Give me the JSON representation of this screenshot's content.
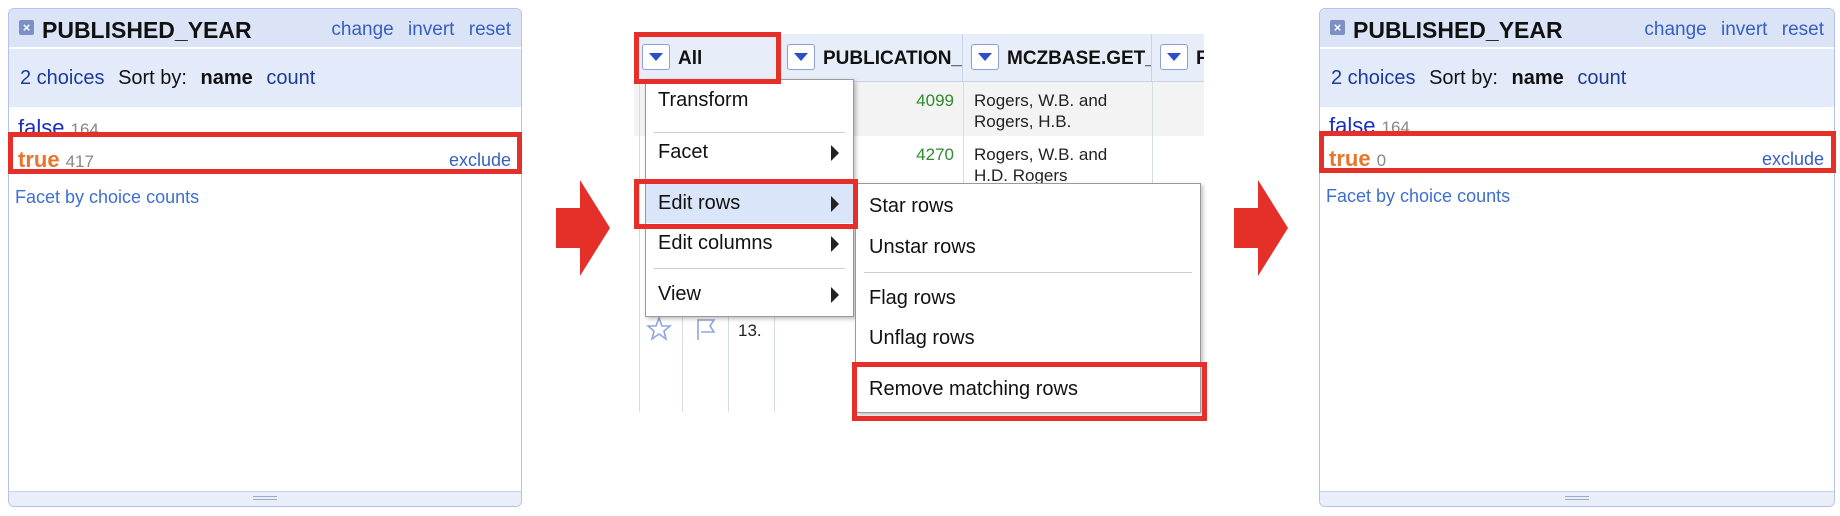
{
  "colors": {
    "highlight_red": "#e5302a",
    "link_blue": "#3560c2",
    "selected_orange": "#e8752c"
  },
  "facet_before": {
    "title": "PUBLISHED_YEAR",
    "links": [
      "change",
      "invert",
      "reset"
    ],
    "choices_label": "2 choices",
    "sort_by": "Sort by:",
    "sort_name": "name",
    "sort_count": "count",
    "items": [
      {
        "name": "false",
        "count": "164"
      },
      {
        "name": "true",
        "count": "417",
        "action": "exclude"
      }
    ],
    "facet_by_counts": "Facet by choice counts"
  },
  "grid": {
    "col_all": "All",
    "col_pub": "PUBLICATION_I",
    "col_mcz": "MCZBASE.GET_",
    "col_more": "F",
    "rows": [
      {
        "num": "4099",
        "author": "Rogers, W.B. and Rogers, H.B."
      },
      {
        "num": "4270",
        "author": "Rogers, W.B. and H.D. Rogers"
      }
    ],
    "row13_index": "13."
  },
  "menu_all": {
    "items": [
      "Transform",
      "Facet",
      "Edit rows",
      "Edit columns",
      "View"
    ]
  },
  "menu_edit_rows": {
    "items": [
      "Star rows",
      "Unstar rows",
      "Flag rows",
      "Unflag rows",
      "Remove matching rows"
    ]
  },
  "facet_after": {
    "title": "PUBLISHED_YEAR",
    "links": [
      "change",
      "invert",
      "reset"
    ],
    "choices_label": "2 choices",
    "sort_by": "Sort by:",
    "sort_name": "name",
    "sort_count": "count",
    "items": [
      {
        "name": "false",
        "count": "164"
      },
      {
        "name": "true",
        "count": "0",
        "action": "exclude"
      }
    ],
    "facet_by_counts": "Facet by choice counts"
  }
}
